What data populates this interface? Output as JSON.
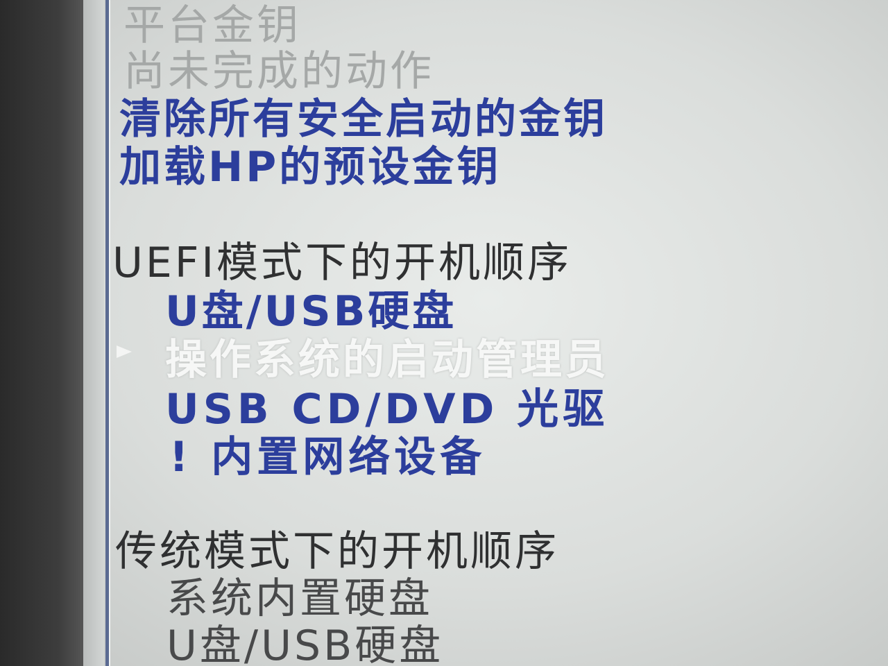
{
  "secure_boot_menu": {
    "platform_key": "平台金钥",
    "pending_action": "尚未完成的动作",
    "clear_all_keys": "清除所有安全启动的金钥",
    "load_hp_default_keys": "加载HP的预设金钥"
  },
  "uefi_boot_order": {
    "header": "UEFI模式下的开机顺序",
    "items": [
      {
        "label": "U盘/USB硬盘",
        "state": "normal"
      },
      {
        "label": "操作系统的启动管理员",
        "state": "selected"
      },
      {
        "label": "USB CD/DVD 光驱",
        "state": "normal"
      },
      {
        "label": "! 内置网络设备",
        "state": "normal"
      }
    ]
  },
  "legacy_boot_order": {
    "header": "传统模式下的开机顺序",
    "items": [
      {
        "label": "系统内置硬盘",
        "state": "disabled"
      },
      {
        "label": "U盘/USB硬盘",
        "state": "disabled"
      }
    ]
  },
  "colors": {
    "link_blue": "#2c3e9c",
    "disabled_gray": "#a5a8a7",
    "header_dark": "#2f3031",
    "selected_white": "#f6f7f6",
    "background": "#dcdfdd"
  }
}
